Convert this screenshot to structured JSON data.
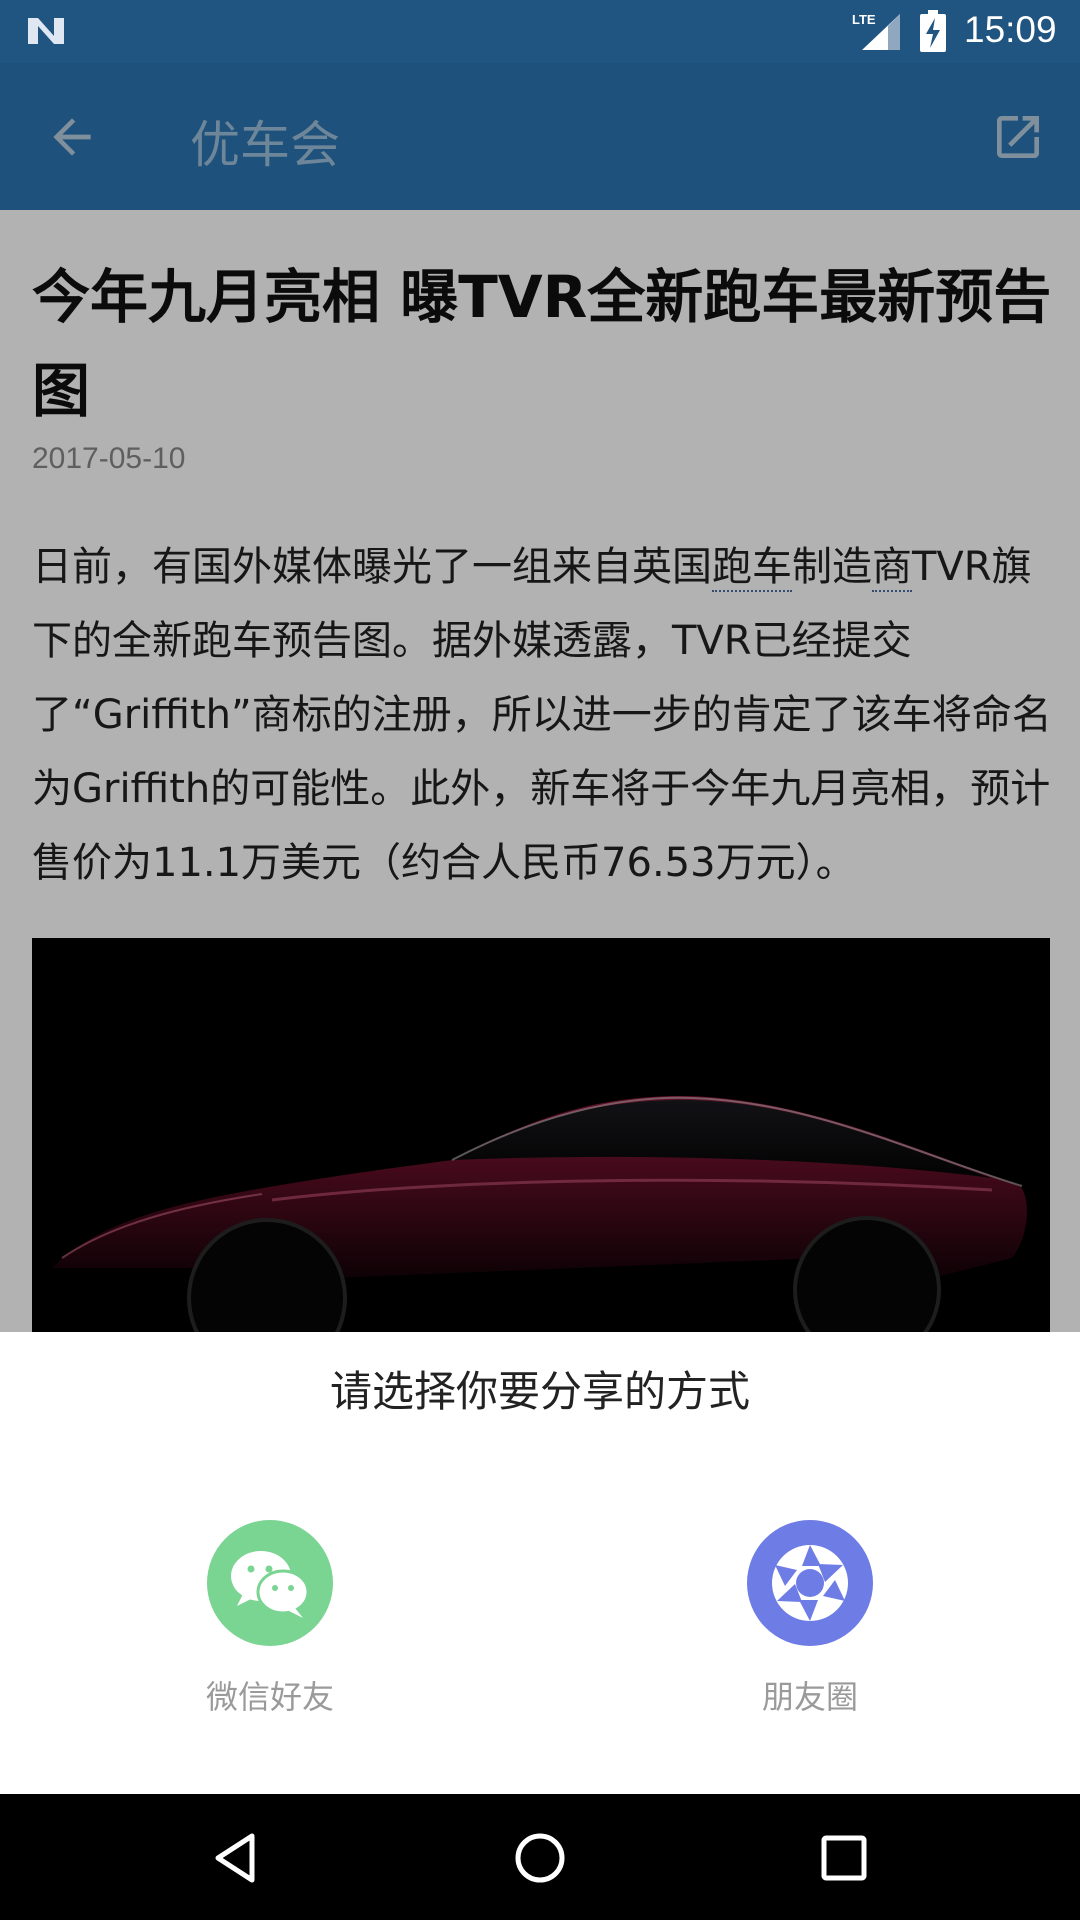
{
  "status_bar": {
    "time": "15:09",
    "network": "LTE",
    "icons": [
      "n-logo-icon",
      "lte-signal-icon",
      "battery-charging-icon"
    ]
  },
  "app_bar": {
    "title": "优车会",
    "back_icon": "arrow-back-icon",
    "open_icon": "open-in-external-icon"
  },
  "article": {
    "headline": "今年九月亮相 曝TVR全新跑车最新预告图",
    "date": "2017-05-10",
    "body": {
      "p1_a": "日前，有国外媒体曝光了一组来自英国",
      "link1": "跑车",
      "p1_b": "制造",
      "link2": "商",
      "p1_c": "TVR旗下的全新跑车预告图。据外媒透露，TVR已经提交了“Griffith”商标的注册，所以进一步的肯定了该车将命名为Griffith的可能性。此外，新车将于今年九月亮相，预计售价为11.1万美元（约合人民币76.53万元）。"
    }
  },
  "share_sheet": {
    "title": "请选择你要分享的方式",
    "options": [
      {
        "label": "微信好友",
        "icon": "wechat-icon",
        "color": "#7ad492"
      },
      {
        "label": "朋友圈",
        "icon": "moments-shutter-icon",
        "color": "#6e7ce6"
      }
    ]
  },
  "nav_bar": {
    "buttons": [
      "nav-back-icon",
      "nav-home-icon",
      "nav-recents-icon"
    ]
  },
  "colors": {
    "status_bar": "#1f5580",
    "app_bar": "#2b74b0",
    "overlay": "rgba(0,0,0,0.30)"
  }
}
